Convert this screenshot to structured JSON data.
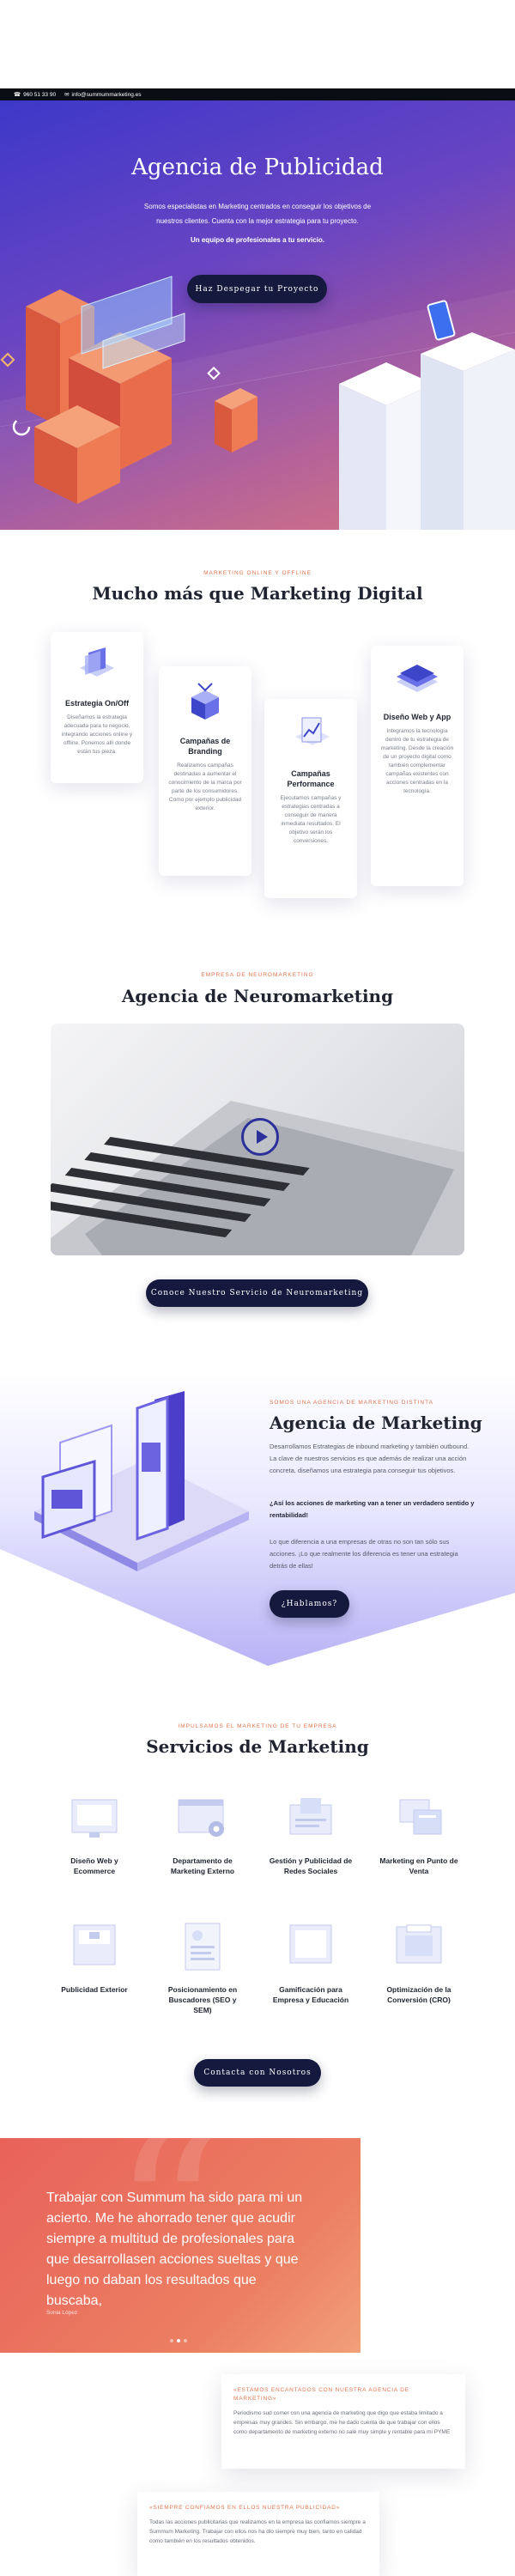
{
  "topbar": {
    "phone": "960 51 33 90",
    "email": "info@summummarketing.es"
  },
  "hero": {
    "title": "Agencia de Publicidad",
    "subtitle": "Somos especialistas en Marketing centrados en conseguir los objetivos de nuestros clientes. Cuenta con la mejor estrategia para tu proyecto.",
    "tagline": "Un equipo de profesionales a tu servicio.",
    "cta": "Haz Despegar tu Proyecto"
  },
  "services_intro": {
    "eyebrow": "MARKETING ONLINE Y OFFLINE",
    "title": "Mucho más que Marketing Digital",
    "cards": [
      {
        "title": "Estrategia On/Off",
        "text": "Diseñamos la estrategia adecuada para tu negocio, integrando acciones online y offline. Ponemos allí donde están tus pieza."
      },
      {
        "title": "Campañas de Branding",
        "text": "Realizamos campañas destinadas a aumentar el conocimiento de la marca por parte de los consumidores. Como por ejemplo publicidad exterior."
      },
      {
        "title": "Campañas Performance",
        "text": "Ejecutamos campañas y estrategias centradas a conseguir de manera inmediata resultados. El objetivo serán los conversiones."
      },
      {
        "title": "Diseño Web y App",
        "text": "Integramos la tecnología dentro de tu estrategia de marketing. Desde la creación de un proyecto digital como también complementar campañas existentes con acciones centradas en la tecnología."
      }
    ]
  },
  "neuro": {
    "eyebrow": "EMPRESA DE NEUROMARKETING",
    "title": "Agencia de Neuromarketing",
    "cta": "Conoce Nuestro Servicio de Neuromarketing"
  },
  "marketing": {
    "eyebrow": "SOMOS UNA AGENCIA DE MARKETING DISTINTA",
    "title": "Agencia de Marketing",
    "p1": "Desarrollamos Estrategias de inbound marketing y también outbound. La clave de nuestros servicios es que además de realizar una acción concreta, diseñamos una estrategia para conseguir tus objetivos.",
    "p2": "¿Así los acciones de marketing van a tener un verdadero sentido y rentabilidad!",
    "p3": "Lo que diferencia a una empresas de otras no son tan sólo sus acciones. ¡Lo que realmente los diferencia es tener una estrategia detrás de ellas!",
    "cta": "¿Hablamos?"
  },
  "servicios": {
    "eyebrow": "IMPULSAMOS EL MARKETING DE TU EMPRESA",
    "title": "Servicios de Marketing",
    "items": [
      {
        "label": "Diseño Web y Ecommerce",
        "icon": "web-design-icon"
      },
      {
        "label": "Departamento de Marketing Externo",
        "icon": "browser-gear-icon"
      },
      {
        "label": "Gestión y Publicidad de Redes Sociales",
        "icon": "social-media-icon"
      },
      {
        "label": "Marketing en Punto de Venta",
        "icon": "pos-icon"
      },
      {
        "label": "Publicidad Exterior",
        "icon": "billboard-icon"
      },
      {
        "label": "Posicionamiento en Buscadores (SEO y SEM)",
        "icon": "seo-document-icon"
      },
      {
        "label": "Gamificación para Empresa y Educación",
        "icon": "gamification-icon"
      },
      {
        "label": "Optimización de la Conversión (CRO)",
        "icon": "conversion-icon"
      }
    ],
    "cta": "Contacta con Nosotros"
  },
  "testimonial": {
    "quote": "Trabajar con Summum ha sido para mi un acierto. Me he ahorrado tener que acudir siempre a multitud de profesionales para que desarrollasen acciones sueltas y que luego no daban los resultados que buscaba,",
    "author": "Sonia López"
  },
  "review1": {
    "title": "«ESTAMOS ENCANTADOS CON NUESTRA AGENCIA DE MARKETING»",
    "text": "Periodismo sud comer con una agencia de marketing que digo que estaba limitado a empresas muy grandes. Sin embargo, me he dado cuenta de que trabajar con ellos como departamento de marketing externo no sale muy simple y rentable para mi PYME"
  },
  "review2": {
    "title": "«SIEMPRE CONFIAMOS EN ELLOS NUESTRA PUBLICIDAD»",
    "text": "Todas las acciones publicitarias que realizamos en la empresa las confiamos siempre a Summum Marketing. Trabajar con ellos nos ha dio siempre muy bien, tanto en calidad como también en los resultados obtenidos."
  },
  "colors": {
    "accent": "#e0764f",
    "navy": "#14193d",
    "hero_start": "#3d38c9",
    "hero_end": "#d8707a",
    "testimonial": "#e8625a"
  }
}
